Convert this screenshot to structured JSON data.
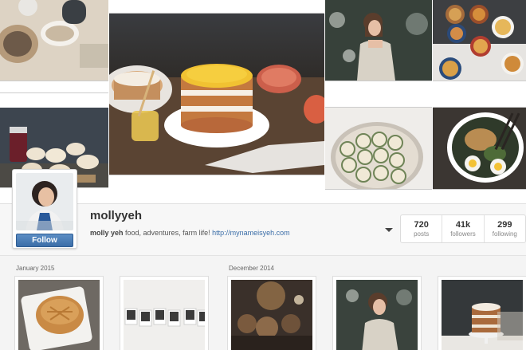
{
  "profile": {
    "username": "mollyyeh",
    "bio_name": "molly yeh",
    "bio_text": " food, adventures, farm life! ",
    "bio_link": "http://mynameisyeh.com",
    "follow_label": "Follow"
  },
  "stats": [
    {
      "value": "720",
      "label": "posts"
    },
    {
      "value": "41k",
      "label": "followers"
    },
    {
      "value": "299",
      "label": "following"
    }
  ],
  "feed": {
    "months": [
      "January 2015",
      "December 2014"
    ]
  },
  "icons": [
    "dropdown-arrow-icon"
  ],
  "colors": {
    "follow_button": "#3c6ea8",
    "link": "#3b6ea8",
    "background": "#f4f4f4"
  }
}
